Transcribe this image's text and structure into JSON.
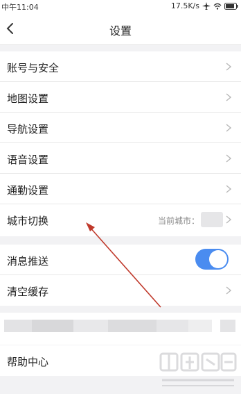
{
  "status_bar": {
    "time": "中午11:04",
    "speed": "17.5K/s"
  },
  "header": {
    "title": "设置"
  },
  "groups": [
    {
      "items": [
        {
          "label": "账号与安全"
        },
        {
          "label": "地图设置"
        },
        {
          "label": "导航设置"
        },
        {
          "label": "语音设置"
        },
        {
          "label": "通勤设置"
        },
        {
          "label": "城市切换",
          "value": "当前城市："
        }
      ]
    },
    {
      "items": [
        {
          "label": "消息推送",
          "toggle_on": true
        },
        {
          "label": "清空缓存"
        }
      ]
    },
    {
      "items": [
        {
          "label": "帮助中心"
        }
      ]
    }
  ],
  "colors": {
    "accent": "#4a8cf0",
    "annotation_arrow": "#c0392b"
  }
}
